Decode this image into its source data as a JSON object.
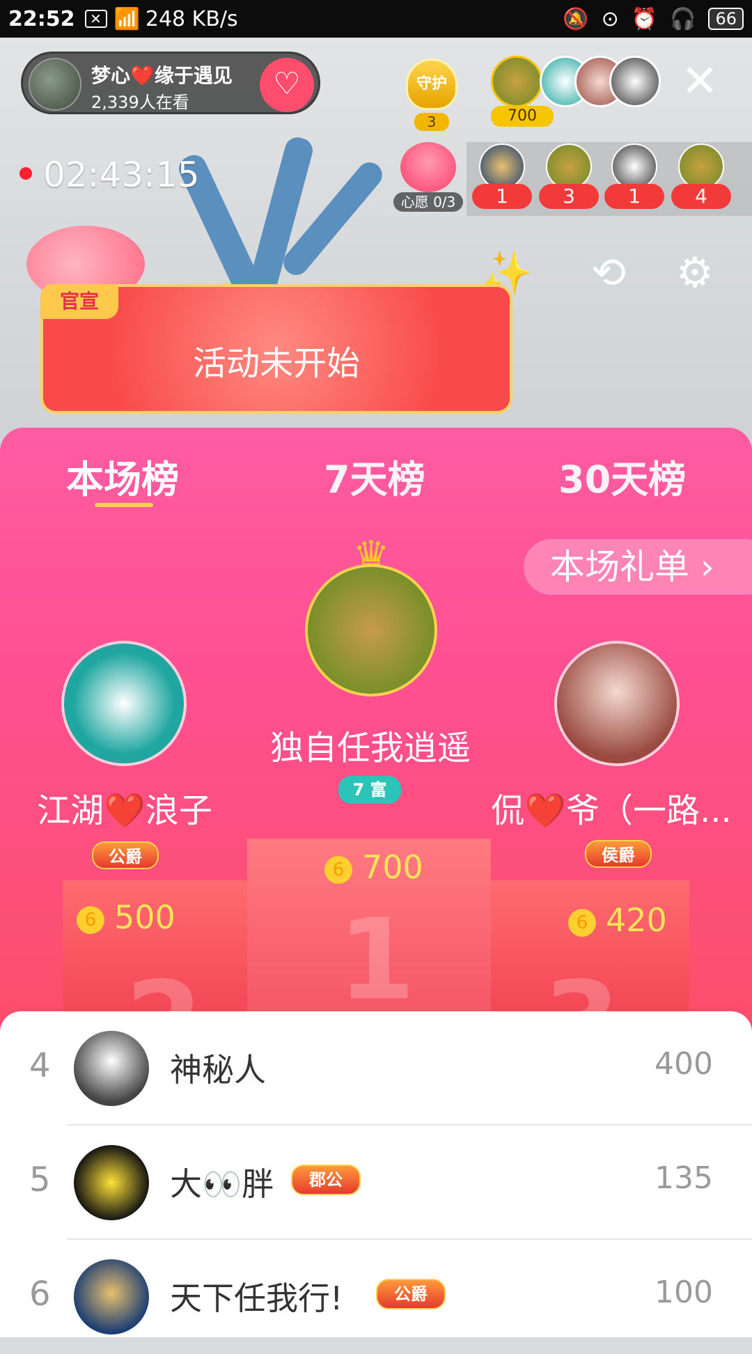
{
  "status_bar": {
    "time": "22:52",
    "speed": "248 KB/s",
    "battery": "66"
  },
  "live_header": {
    "host_name": "梦心❤️缘于遇见",
    "viewer_count": "2,339人在看",
    "guard_label": "守护",
    "guard_count": "3",
    "top_fan_value": "700",
    "timer": "02:43:15",
    "wish_label": "心愿 0/3",
    "gifter_counts": [
      "1",
      "3",
      "1",
      "4"
    ],
    "banner_tag": "官宣",
    "banner_text": "活动未开始"
  },
  "panel": {
    "tabs": [
      "本场榜",
      "7天榜",
      "30天榜"
    ],
    "gift_list_button": "本场礼单 ›",
    "podium_numbers": [
      "2",
      "1",
      "3"
    ]
  },
  "top3": [
    {
      "rank": 1,
      "name": "独自任我逍遥",
      "badge": "7 富",
      "score": "700"
    },
    {
      "rank": 2,
      "name": "江湖❤️浪子",
      "badge": "公爵",
      "score": "500"
    },
    {
      "rank": 3,
      "name": "侃❤️爷（一路...",
      "badge": "侯爵",
      "score": "420"
    }
  ],
  "ranking": [
    {
      "rank": "4",
      "name": "神秘人",
      "badge": "",
      "value": "400"
    },
    {
      "rank": "5",
      "name": "大👀胖",
      "badge": "郡公",
      "value": "135"
    },
    {
      "rank": "6",
      "name": "天下任我行!",
      "badge": "公爵",
      "value": "100"
    }
  ],
  "icons": {
    "close": "close-icon",
    "camera": "camera-switch-icon",
    "settings": "gear-icon",
    "wand": "magic-wand-icon",
    "coin": "coin-icon",
    "crown": "crown-icon"
  },
  "colors": {
    "panel_top": "#ff5ca3",
    "panel_bottom": "#f74a55",
    "score": "#ffe35a",
    "tab_underline": "#ffd24d"
  }
}
